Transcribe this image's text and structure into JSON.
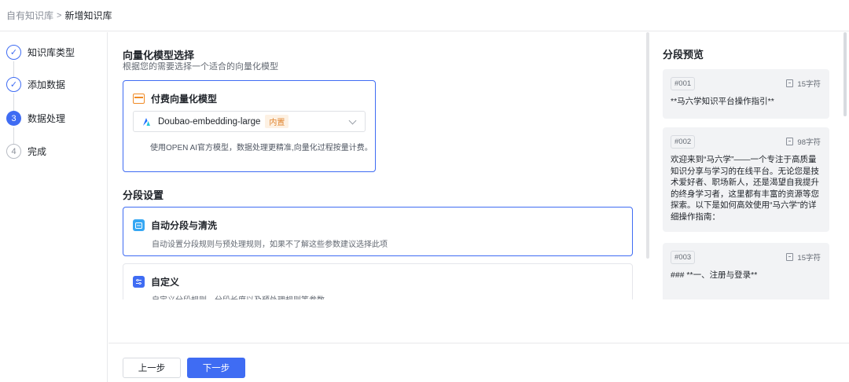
{
  "breadcrumb": {
    "parent": "自有知识库",
    "separator": ">",
    "current": "新增知识库"
  },
  "steps": [
    {
      "label": "知识库类型",
      "state": "done",
      "symbol": "✓"
    },
    {
      "label": "添加数据",
      "state": "done",
      "symbol": "✓"
    },
    {
      "label": "数据处理",
      "state": "active",
      "symbol": "3"
    },
    {
      "label": "完成",
      "state": "todo",
      "symbol": "4"
    }
  ],
  "vector": {
    "title": "向量化模型选择",
    "subtitle": "根据您的需要选择一个适合的向量化模型",
    "card_title": "付费向量化模型",
    "selected_model": "Doubao-embedding-large",
    "model_tag": "内置",
    "description": "使用OPEN AI官方模型，数据处理更精准,向量化过程按量计费。"
  },
  "segment": {
    "title": "分段设置",
    "options": [
      {
        "title": "自动分段与清洗",
        "description": "自动设置分段规则与预处理规则，如果不了解这些参数建议选择此项"
      },
      {
        "title": "自定义",
        "description": "自定义分段规则、分段长度以及预处理规则等参数"
      }
    ]
  },
  "buttons": {
    "prev": "上一步",
    "next": "下一步"
  },
  "preview": {
    "title": "分段预览",
    "chunks": [
      {
        "id": "#001",
        "count": "15字符",
        "text": "**马六学知识平台操作指引**"
      },
      {
        "id": "#002",
        "count": "98字符",
        "text": "欢迎来到“马六学”——一个专注于高质量知识分享与学习的在线平台。无论您是技术爱好者、职场新人，还是渴望自我提升的终身学习者，这里都有丰富的资源等您探索。以下是如何高效使用“马六学”的详细操作指南："
      },
      {
        "id": "#003",
        "count": "15字符",
        "text": "### **一、注册与登录**"
      }
    ]
  },
  "colors": {
    "primary": "#3f6cf3",
    "orange": "#f08a24",
    "border": "#e8e9eb"
  }
}
